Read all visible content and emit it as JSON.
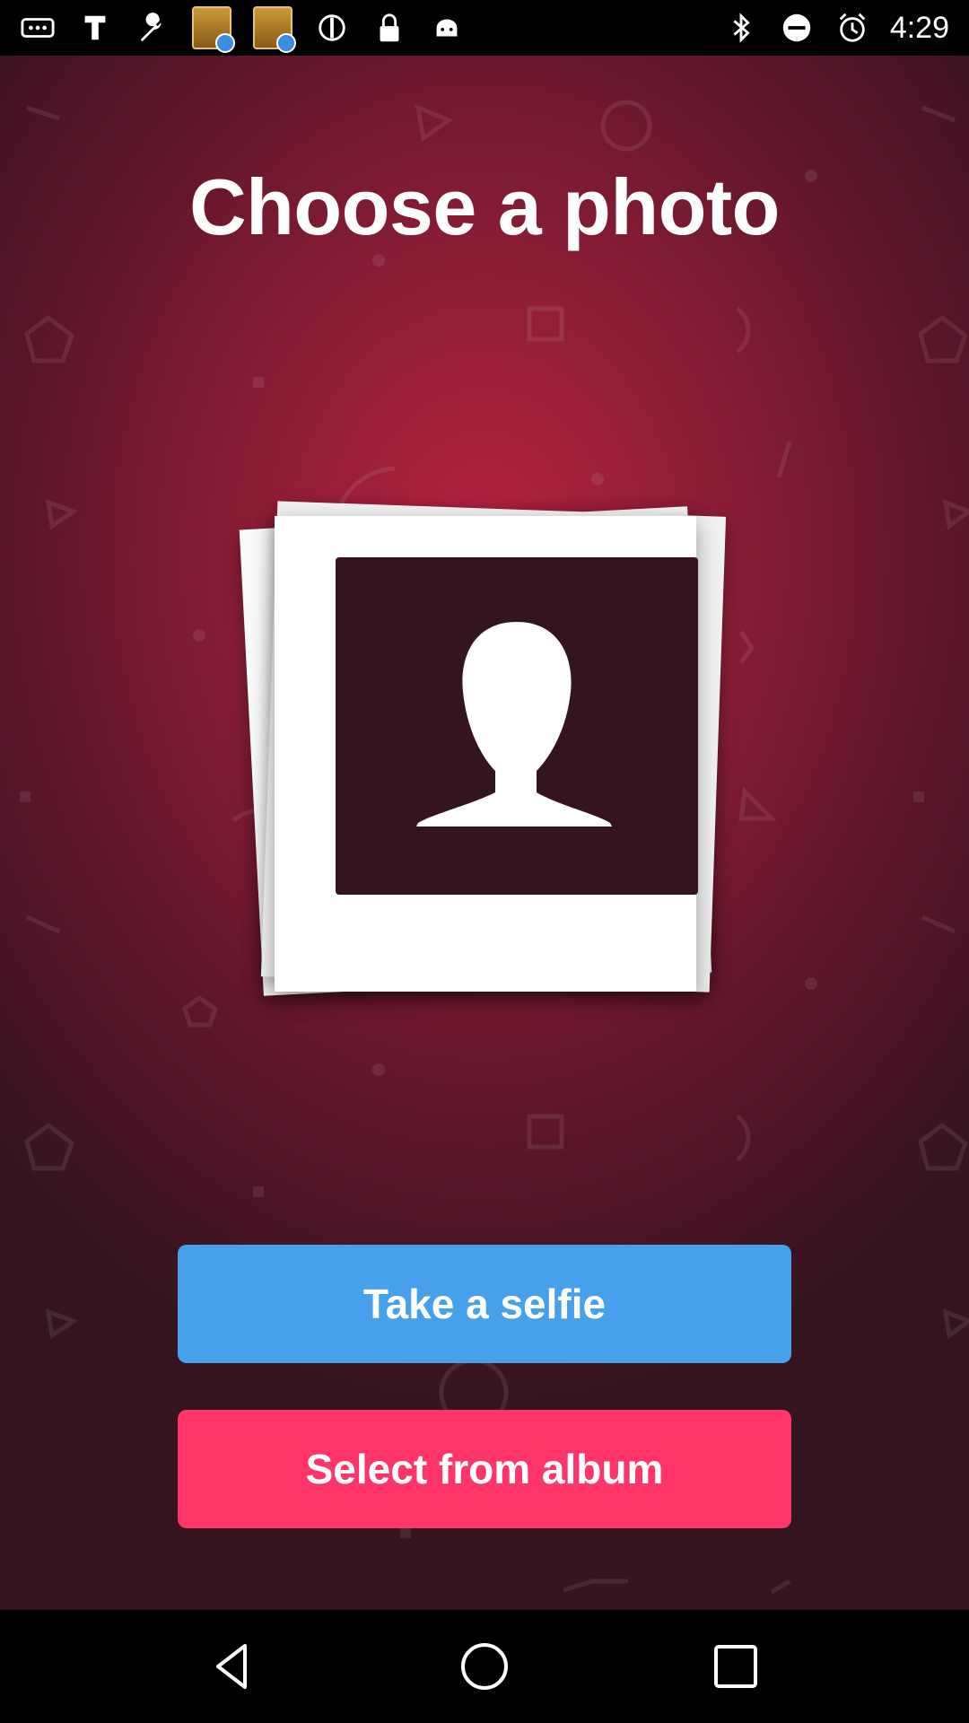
{
  "status_bar": {
    "time": "4:29",
    "left_icons": [
      "more-icon",
      "hashtag-icon",
      "wrench-icon",
      "topics-app-icon",
      "topics-app-icon",
      "circle-icon",
      "lock-icon",
      "android-icon"
    ],
    "right_icons": [
      "bluetooth-icon",
      "minus-circle-icon",
      "alarm-icon"
    ]
  },
  "screen": {
    "title": "Choose a photo",
    "buttons": {
      "selfie": "Take a selfie",
      "album": "Select from album"
    }
  },
  "colors": {
    "selfie_button": "#47a0ea",
    "album_button": "#ff3468",
    "background_center": "#b4213f",
    "background_edge": "#34141f"
  },
  "nav_bar": {
    "icons": [
      "back-icon",
      "home-icon",
      "recents-icon"
    ]
  }
}
